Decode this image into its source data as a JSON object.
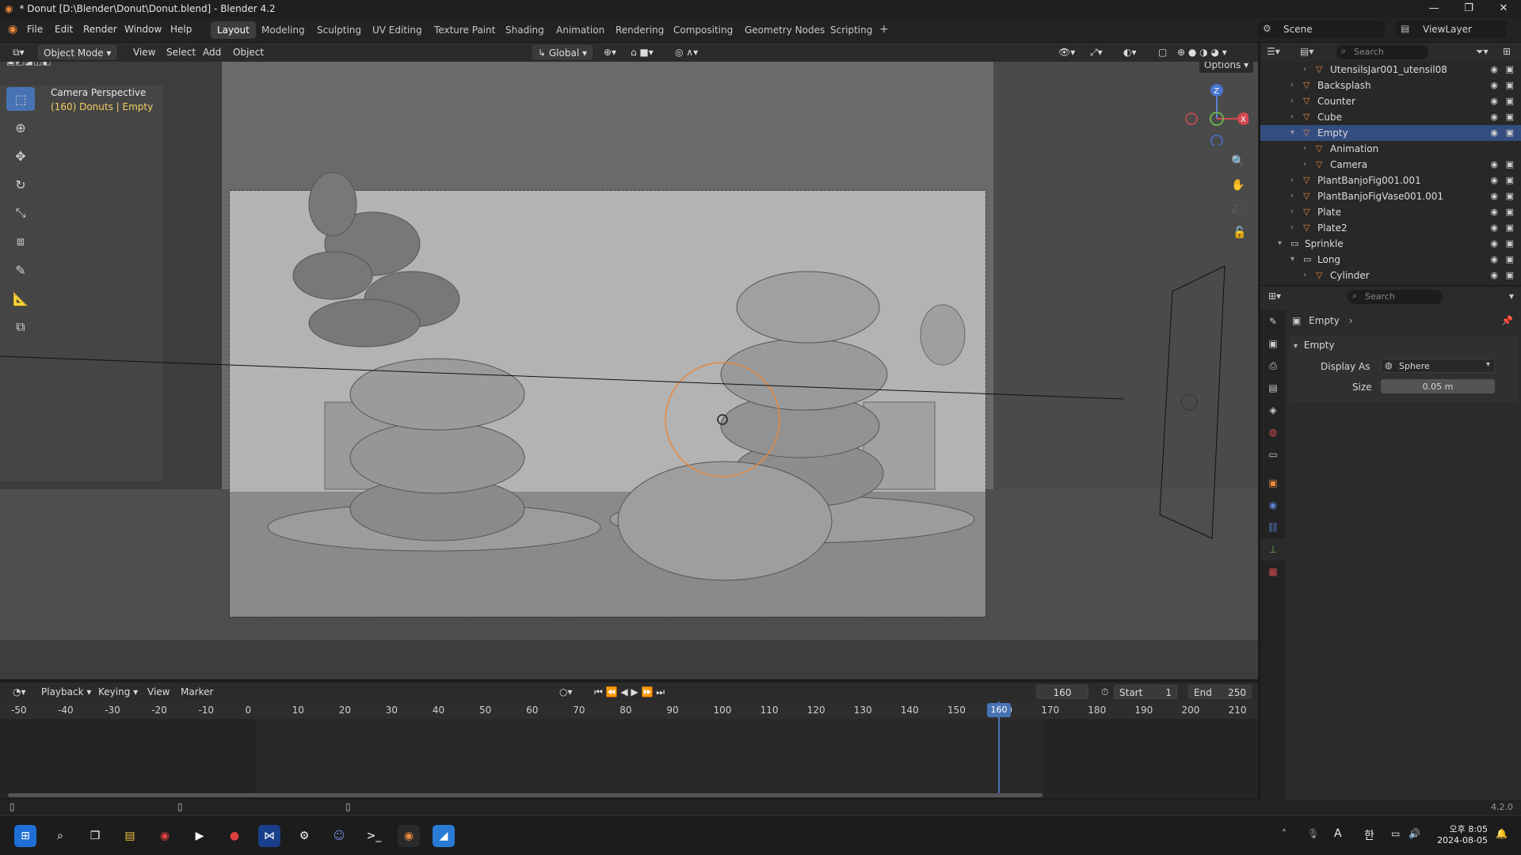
{
  "window": {
    "title": "* Donut [D:\\Blender\\Donut\\Donut.blend] - Blender 4.2"
  },
  "menu": [
    "File",
    "Edit",
    "Render",
    "Window",
    "Help"
  ],
  "workspaces": [
    "Layout",
    "Modeling",
    "Sculpting",
    "UV Editing",
    "Texture Paint",
    "Shading",
    "Animation",
    "Rendering",
    "Compositing",
    "Geometry Nodes",
    "Scripting"
  ],
  "scene": {
    "label": "Scene",
    "view_layer": "ViewLayer"
  },
  "viewport_header": {
    "mode": "Object Mode",
    "view": "View",
    "select": "Select",
    "add": "Add",
    "object": "Object",
    "transform": "Global",
    "options": "Options"
  },
  "viewport_info": {
    "line1": "Camera Perspective",
    "line2": "(160) Donuts | Empty"
  },
  "outliner": {
    "search_placeholder": "Search",
    "rows": [
      {
        "label": "UtensilsJar001_utensil08",
        "indent": 2
      },
      {
        "label": "Backsplash",
        "indent": 1
      },
      {
        "label": "Counter",
        "indent": 1
      },
      {
        "label": "Cube",
        "indent": 1
      },
      {
        "label": "Empty",
        "indent": 1,
        "selected": true
      },
      {
        "label": "Animation",
        "indent": 2
      },
      {
        "label": "Camera",
        "indent": 2
      },
      {
        "label": "PlantBanjoFig001.001",
        "indent": 1
      },
      {
        "label": "PlantBanjoFigVase001.001",
        "indent": 1
      },
      {
        "label": "Plate",
        "indent": 1
      },
      {
        "label": "Plate2",
        "indent": 1
      },
      {
        "label": "Sprinkle",
        "indent": 0
      },
      {
        "label": "Long",
        "indent": 1
      },
      {
        "label": "Cylinder",
        "indent": 2
      }
    ]
  },
  "properties": {
    "search_placeholder": "Search",
    "breadcrumb": "Empty",
    "panel_title": "Empty",
    "display_as_label": "Display As",
    "display_as_value": "Sphere",
    "size_label": "Size",
    "size_value": "0.05 m"
  },
  "timeline": {
    "playback": "Playback",
    "keying": "Keying",
    "view": "View",
    "marker": "Marker",
    "current_frame": "160",
    "start_label": "Start",
    "start_value": "1",
    "end_label": "End",
    "end_value": "250",
    "ticks": [
      "-50",
      "-40",
      "-30",
      "-20",
      "-10",
      "0",
      "10",
      "20",
      "30",
      "40",
      "50",
      "60",
      "70",
      "80",
      "90",
      "100",
      "110",
      "120",
      "130",
      "140",
      "150",
      "160",
      "170",
      "180",
      "190",
      "200",
      "210"
    ]
  },
  "statusbar": {
    "version": "4.2.0"
  },
  "taskbar": {
    "time": "오후 8:05",
    "date": "2024-08-05",
    "ime": "A",
    "ime2": "한"
  },
  "colors": {
    "accent": "#4772b3",
    "selection": "#334d80",
    "orange": "#e8893e"
  }
}
